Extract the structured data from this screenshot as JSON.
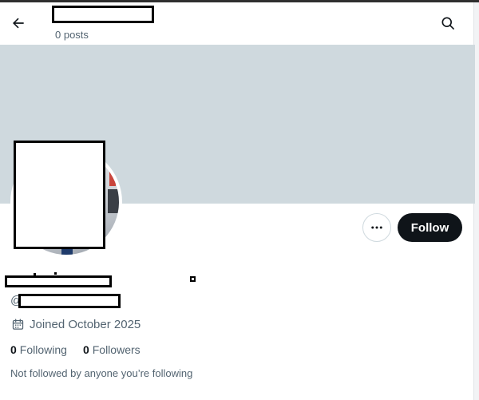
{
  "header": {
    "posts_count": "0 posts",
    "back_icon": "arrow-left-icon",
    "search_icon": "search-icon"
  },
  "banner": {
    "color": "#cfd9de"
  },
  "actions": {
    "more_icon": "more-horizontal-icon",
    "follow_label": "Follow"
  },
  "profile": {
    "at_symbol": "@",
    "joined_text": "Joined October 2025",
    "calendar_icon": "calendar-icon",
    "following_count": "0",
    "following_label": "Following",
    "followers_count": "0",
    "followers_label": "Followers",
    "not_followed_text": "Not followed by anyone you’re following"
  },
  "colors": {
    "text_primary": "#0f1419",
    "text_secondary": "#536471",
    "follow_button_bg": "#0f1419",
    "banner": "#cfd9de"
  }
}
